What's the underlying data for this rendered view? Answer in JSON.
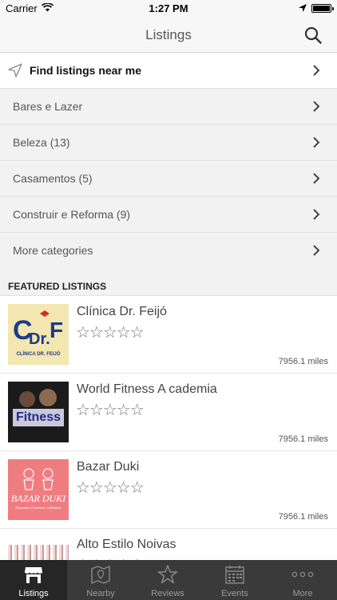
{
  "status": {
    "carrier": "Carrier",
    "time": "1:27 PM"
  },
  "header": {
    "title": "Listings"
  },
  "near": {
    "label": "Find listings near me"
  },
  "categories": [
    {
      "label": "Bares e Lazer"
    },
    {
      "label": "Beleza (13)"
    },
    {
      "label": "Casamentos (5)"
    },
    {
      "label": "Construir e Reforma (9)"
    },
    {
      "label": "More categories"
    }
  ],
  "featured": {
    "heading": "FEATURED LISTINGS",
    "items": [
      {
        "name": "Clínica Dr. Feijó",
        "stars": "☆☆☆☆☆",
        "distance": "7956.1 miles",
        "thumb_text": "CLÍNICA DR. FEIJÓ",
        "logo_text": "C Dr.F"
      },
      {
        "name": "World Fitness A cademia",
        "stars": "☆☆☆☆☆",
        "distance": "7956.1 miles",
        "thumb_text": "Fitness"
      },
      {
        "name": "Bazar Duki",
        "stars": "☆☆☆☆☆",
        "distance": "7956.1 miles",
        "thumb_text": "BAZAR DUKI",
        "thumb_sub": "Papelaria, Presentes, Utilidades"
      },
      {
        "name": "Alto Estilo Noivas",
        "stars": "☆☆☆☆☆",
        "distance": ""
      }
    ]
  },
  "tabs": [
    {
      "label": "Listings",
      "icon": "store-icon",
      "active": true
    },
    {
      "label": "Nearby",
      "icon": "map-icon"
    },
    {
      "label": "Reviews",
      "icon": "star-icon"
    },
    {
      "label": "Events",
      "icon": "calendar-icon"
    },
    {
      "label": "More",
      "icon": "more-icon"
    }
  ],
  "colors": {
    "tabbar": "#3a3a3a",
    "tab_active": "#262626",
    "row_bg": "#f2f2f2"
  }
}
